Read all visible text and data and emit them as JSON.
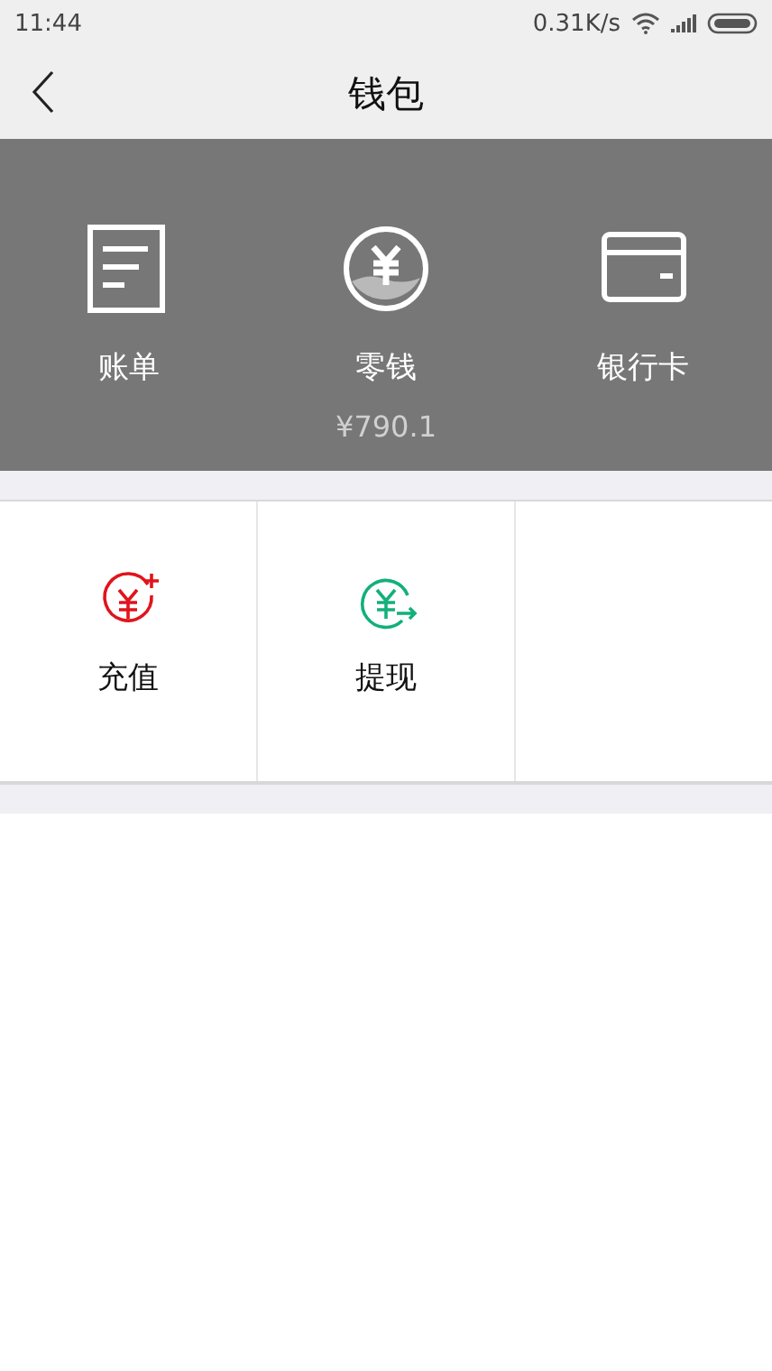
{
  "status_bar": {
    "time": "11:44",
    "net_speed": "0.31K/s"
  },
  "header": {
    "title": "钱包"
  },
  "wallet_items": [
    {
      "kind": "bill",
      "label": "账单"
    },
    {
      "kind": "change",
      "label": "零钱",
      "amount": "¥790.1"
    },
    {
      "kind": "card",
      "label": "银行卡"
    }
  ],
  "actions": [
    {
      "kind": "recharge",
      "label": "充值"
    },
    {
      "kind": "withdraw",
      "label": "提现"
    }
  ]
}
